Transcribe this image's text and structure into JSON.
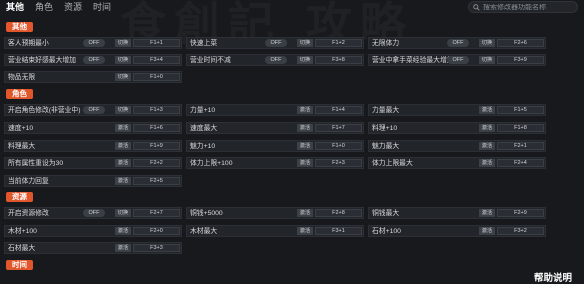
{
  "tabs": [
    "其他",
    "角色",
    "资源",
    "时间"
  ],
  "search": {
    "placeholder": "搜索修改器功能名称"
  },
  "sections": {
    "other": "其他",
    "role": "角色",
    "resource": "资源",
    "time": "时间"
  },
  "items": [
    {
      "label": "客人预期最小",
      "control": "OFF",
      "button": "切换",
      "key": "F1+1"
    },
    {
      "label": "快速上菜",
      "control": "OFF",
      "button": "切换",
      "key": "F1+2"
    },
    {
      "label": "无限体力",
      "control": "OFF",
      "button": "切换",
      "key": "F2+6"
    },
    {
      "label": "营业结束好感最大增加",
      "control": "OFF",
      "button": "切换",
      "key": "F3+4"
    },
    {
      "label": "营业时间不减",
      "control": "OFF",
      "button": "切换",
      "key": "F3+8"
    },
    {
      "label": "营业中拿手菜经验最大增加",
      "control": "OFF",
      "button": "切换",
      "key": "F3+9"
    },
    {
      "label": "物品无限",
      "control": "",
      "button": "切换",
      "key": "F1+0"
    },
    {
      "label": "开启角色修改(非营业中)",
      "control": "OFF",
      "button": "切换",
      "key": "F1+3"
    },
    {
      "label": "力量+10",
      "control": "",
      "button": "激活",
      "key": "F1+4"
    },
    {
      "label": "力量最大",
      "control": "",
      "button": "激活",
      "key": "F1+5"
    },
    {
      "label": "速度+10",
      "control": "",
      "button": "激活",
      "key": "F1+6"
    },
    {
      "label": "速度最大",
      "control": "",
      "button": "激活",
      "key": "F1+7"
    },
    {
      "label": "料理+10",
      "control": "",
      "button": "激活",
      "key": "F1+8"
    },
    {
      "label": "料理最大",
      "control": "",
      "button": "激活",
      "key": "F1+9"
    },
    {
      "label": "魅力+10",
      "control": "",
      "button": "激活",
      "key": "F1+0"
    },
    {
      "label": "魅力最大",
      "control": "",
      "button": "激活",
      "key": "F2+1"
    },
    {
      "label": "所有属性重设为30",
      "control": "",
      "button": "激活",
      "key": "F2+2"
    },
    {
      "label": "体力上限+100",
      "control": "",
      "button": "激活",
      "key": "F2+3"
    },
    {
      "label": "体力上限最大",
      "control": "",
      "button": "激活",
      "key": "F2+4"
    },
    {
      "label": "当前体力回复",
      "control": "",
      "button": "激活",
      "key": "F2+5"
    },
    {
      "label": "开启资源修改",
      "control": "OFF",
      "button": "切换",
      "key": "F2+7"
    },
    {
      "label": "铜钱+5000",
      "control": "",
      "button": "激活",
      "key": "F2+8"
    },
    {
      "label": "铜钱最大",
      "control": "",
      "button": "激活",
      "key": "F2+9"
    },
    {
      "label": "木材+100",
      "control": "",
      "button": "激活",
      "key": "F2+0"
    },
    {
      "label": "木材最大",
      "control": "",
      "button": "激活",
      "key": "F3+1"
    },
    {
      "label": "石材+100",
      "control": "",
      "button": "激活",
      "key": "F3+2"
    },
    {
      "label": "石材最大",
      "control": "",
      "button": "激活",
      "key": "F3+3"
    }
  ],
  "help": "帮助说明"
}
